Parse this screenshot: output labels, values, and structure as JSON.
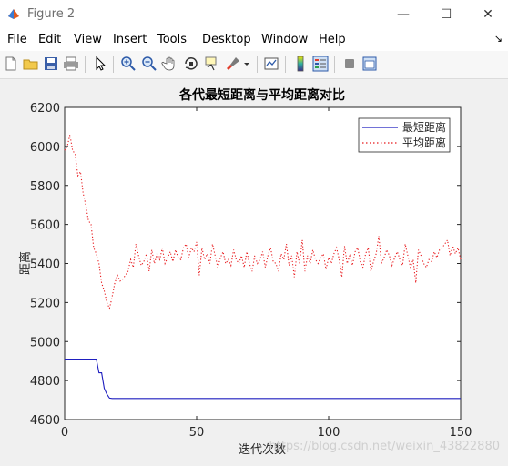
{
  "window": {
    "title": "Figure 2",
    "minimize_glyph": "—",
    "maximize_glyph": "☐",
    "close_glyph": "✕"
  },
  "menu": {
    "items": [
      "File",
      "Edit",
      "View",
      "Insert",
      "Tools",
      "Desktop",
      "Window",
      "Help"
    ],
    "overflow_glyph": "↘"
  },
  "toolbar": {
    "icons": [
      "new-figure-icon",
      "open-file-icon",
      "save-icon",
      "print-icon",
      "edit-plot-icon",
      "zoom-in-icon",
      "zoom-out-icon",
      "pan-hand-icon",
      "rotate-3d-icon",
      "data-cursor-icon",
      "brush-icon",
      "link-plot-icon",
      "colorbar-icon",
      "legend-icon",
      "hide-plot-tools-icon",
      "show-plot-tools-icon"
    ]
  },
  "colors": {
    "shortest_line": "#1f1fbf",
    "average_line": "#e8191c",
    "axes_bg": "#ffffff",
    "figure_bg": "#f0f0f0"
  },
  "watermark": "https://blog.csdn.net/weixin_43822880",
  "chart_data": {
    "type": "line",
    "title": "各代最短距离与平均距离对比",
    "xlabel": "迭代次数",
    "ylabel": "距离",
    "xlim": [
      0,
      150
    ],
    "ylim": [
      4600,
      6200
    ],
    "xticks": [
      0,
      50,
      100,
      150
    ],
    "yticks": [
      4600,
      4800,
      5000,
      5200,
      5400,
      5600,
      5800,
      6000,
      6200
    ],
    "grid": false,
    "legend_position": "top-right",
    "series": [
      {
        "name": "最短距离",
        "style": "solid",
        "x": [
          0,
          12,
          13,
          14,
          15,
          16,
          17,
          18,
          150
        ],
        "y": [
          4910,
          4910,
          4840,
          4840,
          4760,
          4730,
          4710,
          4708,
          4708
        ]
      },
      {
        "name": "平均距离",
        "style": "dotted",
        "x": [
          0,
          1,
          2,
          3,
          4,
          5,
          6,
          7,
          8,
          9,
          10,
          11,
          12,
          13,
          14,
          15,
          16,
          17,
          18,
          19,
          20,
          21,
          22,
          23,
          24,
          25,
          26,
          27,
          28,
          29,
          30,
          31,
          32,
          33,
          34,
          35,
          36,
          37,
          38,
          39,
          40,
          41,
          42,
          43,
          44,
          45,
          46,
          47,
          48,
          49,
          50,
          51,
          52,
          53,
          54,
          55,
          56,
          57,
          58,
          59,
          60,
          61,
          62,
          63,
          64,
          65,
          66,
          67,
          68,
          69,
          70,
          71,
          72,
          73,
          74,
          75,
          76,
          77,
          78,
          79,
          80,
          81,
          82,
          83,
          84,
          85,
          86,
          87,
          88,
          89,
          90,
          91,
          92,
          93,
          94,
          95,
          96,
          97,
          98,
          99,
          100,
          101,
          102,
          103,
          104,
          105,
          106,
          107,
          108,
          109,
          110,
          111,
          112,
          113,
          114,
          115,
          116,
          117,
          118,
          119,
          120,
          121,
          122,
          123,
          124,
          125,
          126,
          127,
          128,
          129,
          130,
          131,
          132,
          133,
          134,
          135,
          136,
          137,
          138,
          139,
          140,
          141,
          142,
          143,
          144,
          145,
          146,
          147,
          148,
          149,
          150
        ],
        "y": [
          5980,
          6000,
          6060,
          5980,
          5960,
          5850,
          5870,
          5760,
          5700,
          5620,
          5600,
          5480,
          5450,
          5400,
          5300,
          5260,
          5200,
          5170,
          5230,
          5300,
          5340,
          5310,
          5320,
          5340,
          5360,
          5420,
          5380,
          5500,
          5440,
          5390,
          5410,
          5450,
          5360,
          5470,
          5400,
          5450,
          5420,
          5480,
          5400,
          5430,
          5460,
          5410,
          5470,
          5430,
          5420,
          5480,
          5500,
          5430,
          5480,
          5460,
          5510,
          5340,
          5480,
          5420,
          5450,
          5400,
          5500,
          5440,
          5380,
          5430,
          5460,
          5400,
          5420,
          5390,
          5470,
          5420,
          5400,
          5440,
          5380,
          5460,
          5400,
          5360,
          5440,
          5400,
          5420,
          5460,
          5380,
          5440,
          5480,
          5410,
          5400,
          5360,
          5450,
          5420,
          5500,
          5390,
          5440,
          5330,
          5460,
          5400,
          5520,
          5360,
          5440,
          5400,
          5470,
          5420,
          5400,
          5430,
          5450,
          5370,
          5430,
          5400,
          5450,
          5480,
          5420,
          5330,
          5490,
          5400,
          5440,
          5390,
          5460,
          5480,
          5410,
          5380,
          5450,
          5480,
          5360,
          5410,
          5450,
          5540,
          5400,
          5430,
          5470,
          5440,
          5390,
          5430,
          5460,
          5420,
          5390,
          5500,
          5440,
          5380,
          5420,
          5300,
          5470,
          5440,
          5400,
          5380,
          5420,
          5410,
          5460,
          5430,
          5470,
          5480,
          5500,
          5520,
          5440,
          5490,
          5450,
          5480,
          5420
        ]
      }
    ]
  }
}
